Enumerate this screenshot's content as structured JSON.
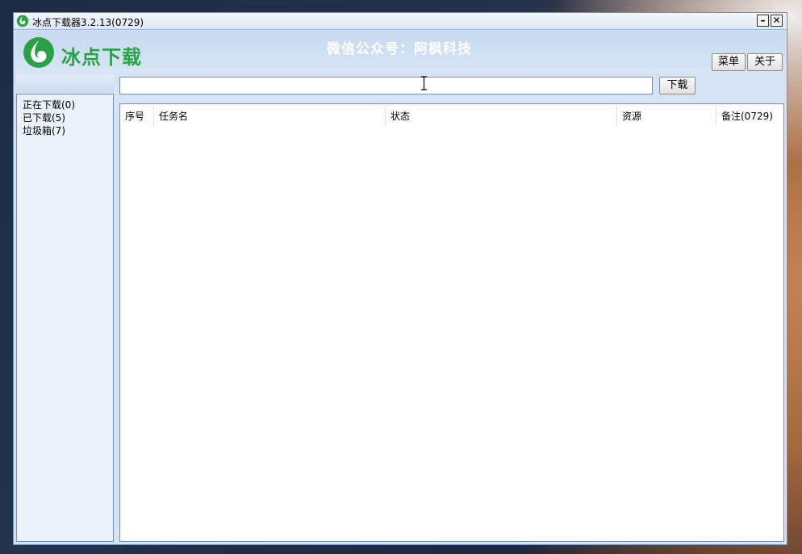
{
  "window": {
    "title": "冰点下载器3.2.13(0729)",
    "minimize_glyph": "–",
    "close_glyph": "✕"
  },
  "header": {
    "logo_text": "冰点下载",
    "wechat_text": "微信公众号：阿枫科技",
    "menu_label": "菜单",
    "about_label": "关于"
  },
  "toolbar": {
    "url_value": "",
    "download_label": "下载"
  },
  "sidebar": {
    "items": [
      {
        "label": "正在下载(0)"
      },
      {
        "label": "已下载(5)"
      },
      {
        "label": "垃圾箱(7)"
      }
    ]
  },
  "table": {
    "columns": [
      "序号",
      "任务名",
      "状态",
      "资源",
      "备注(0729)"
    ],
    "rows": []
  },
  "colors": {
    "brand_green": "#2aa146",
    "window_frame": "#d5e3f4"
  },
  "icons": {
    "app": "ice-point-logo-icon",
    "minimize": "minimize-icon",
    "close": "close-icon",
    "cursor": "ibeam-cursor-icon"
  }
}
